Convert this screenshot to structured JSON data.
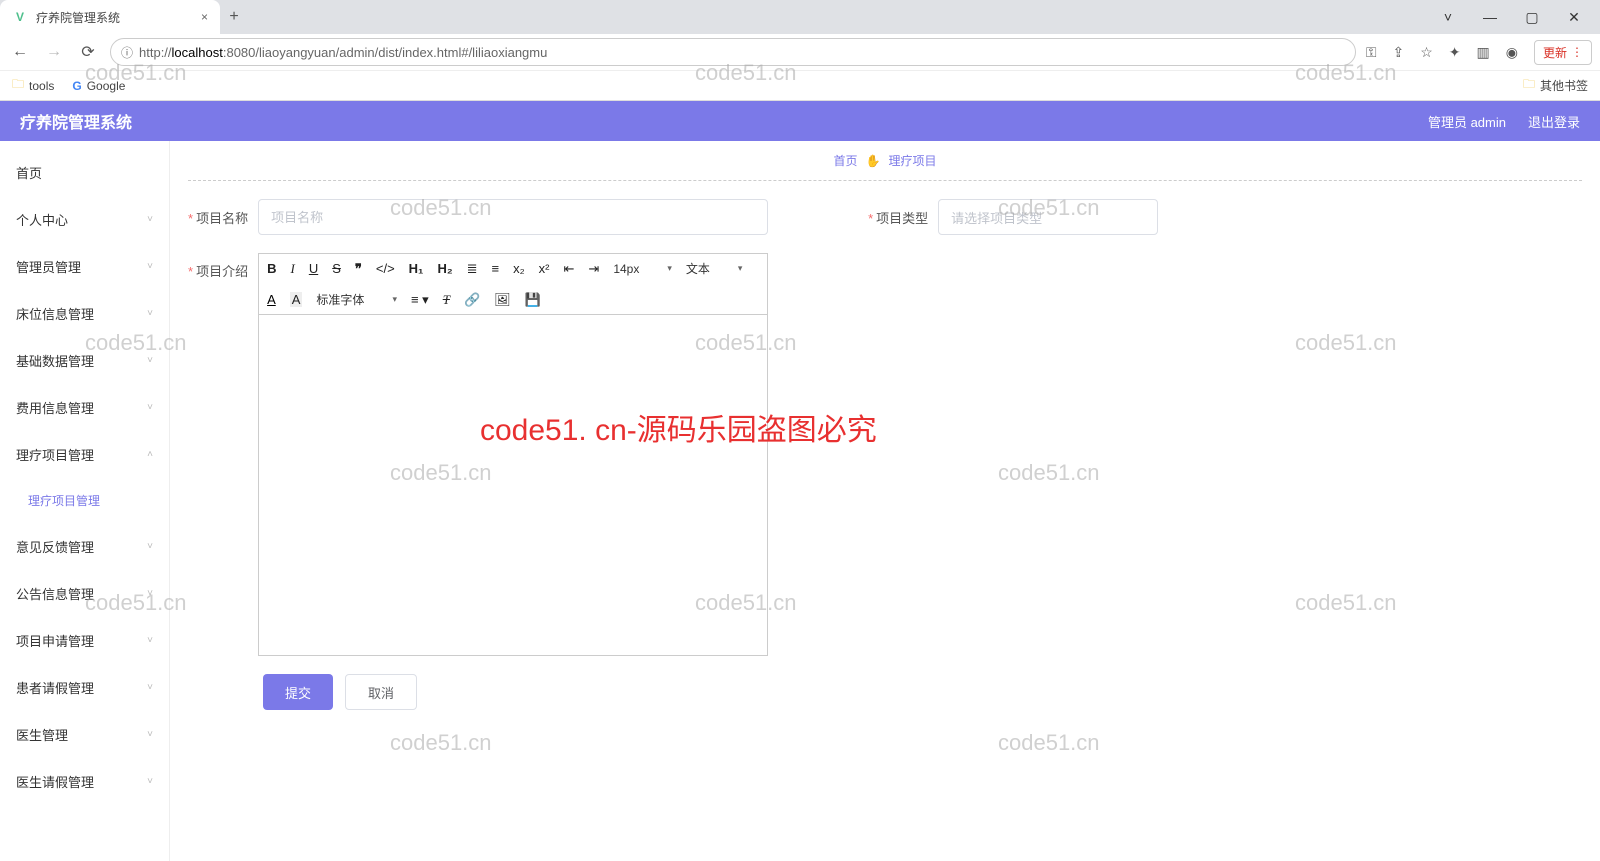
{
  "browser": {
    "tab_title": "疗养院管理系统",
    "url_prefix": "http://",
    "url_host": "localhost",
    "url_path": ":8080/liaoyangyuan/admin/dist/index.html#/liliaoxiangmu",
    "update_label": "更新",
    "bookmarks": {
      "tools": "tools",
      "google": "Google",
      "other": "其他书签"
    }
  },
  "header": {
    "app_title": "疗养院管理系统",
    "user_label": "管理员 admin",
    "logout": "退出登录"
  },
  "sidebar": {
    "items": [
      {
        "label": "首页",
        "expandable": false
      },
      {
        "label": "个人中心",
        "expandable": true
      },
      {
        "label": "管理员管理",
        "expandable": true
      },
      {
        "label": "床位信息管理",
        "expandable": true
      },
      {
        "label": "基础数据管理",
        "expandable": true
      },
      {
        "label": "费用信息管理",
        "expandable": true
      },
      {
        "label": "理疗项目管理",
        "expandable": true,
        "expanded": true
      },
      {
        "label": "理疗项目管理",
        "sub": true
      },
      {
        "label": "意见反馈管理",
        "expandable": true
      },
      {
        "label": "公告信息管理",
        "expandable": true
      },
      {
        "label": "项目申请管理",
        "expandable": true
      },
      {
        "label": "患者请假管理",
        "expandable": true
      },
      {
        "label": "医生管理",
        "expandable": true
      },
      {
        "label": "医生请假管理",
        "expandable": true
      }
    ]
  },
  "breadcrumb": {
    "home": "首页",
    "current": "理疗项目"
  },
  "form": {
    "name_label": "项目名称",
    "name_placeholder": "项目名称",
    "type_label": "项目类型",
    "type_placeholder": "请选择项目类型",
    "intro_label": "项目介绍",
    "submit": "提交",
    "cancel": "取消"
  },
  "editor": {
    "fontsize": "14px",
    "style": "文本",
    "fontfamily": "标准字体"
  },
  "watermark": {
    "small": "code51.cn",
    "big": "code51. cn-源码乐园盗图必究"
  }
}
